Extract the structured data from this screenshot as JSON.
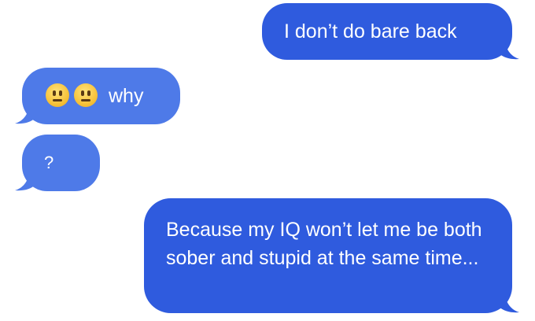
{
  "conversation": {
    "messages": [
      {
        "direction": "outgoing",
        "text": "I don’t do bare back"
      },
      {
        "direction": "incoming",
        "emojis": [
          "neutral-face",
          "neutral-face"
        ],
        "text": "why"
      },
      {
        "direction": "incoming",
        "text": "?"
      },
      {
        "direction": "outgoing",
        "text": "Because my IQ won’t let me be both sober and stupid at the same time..."
      }
    ]
  },
  "colors": {
    "outgoing_bubble": "#2f5bde",
    "incoming_bubble": "#4e7ae8",
    "text": "#ffffff",
    "background": "#ffffff"
  }
}
